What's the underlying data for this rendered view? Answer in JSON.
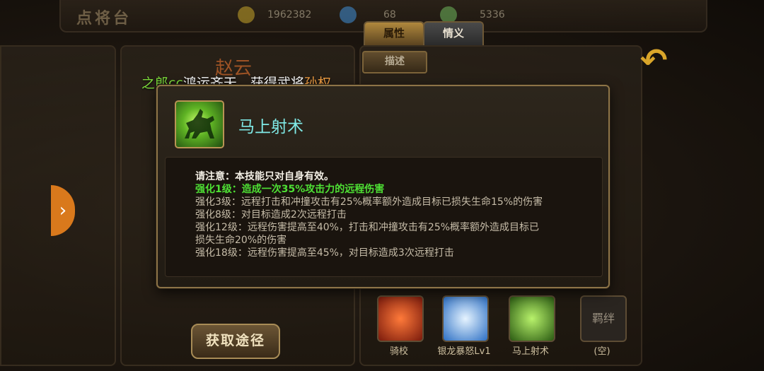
{
  "top_bar": {
    "title": "点将台",
    "resources": [
      {
        "icon": "coin-plus-icon",
        "value": "1962382",
        "color": "#c8a62a"
      },
      {
        "icon": "gem-plus-icon",
        "value": "68",
        "color": "#3f8fd9"
      },
      {
        "icon": "soul-icon",
        "value": "5336",
        "color": "#6fb85d"
      }
    ]
  },
  "tabs": [
    {
      "label": "属性",
      "active": true
    },
    {
      "label": "情义",
      "active": false
    }
  ],
  "subtab": {
    "label": "描述"
  },
  "hero": {
    "name": "赵云"
  },
  "broadcast": {
    "player": "之郎cc",
    "text1": "鸿运齐天，获得武将",
    "hero": "孙权",
    "text2": "。"
  },
  "popup": {
    "skill_name": "马上射术",
    "skill_icon": "horse-archer-icon",
    "lines": [
      {
        "text": "请注意：本技能只对自身有效。",
        "style": "note"
      },
      {
        "text": "强化1级：造成一次35%攻击力的远程伤害",
        "style": "green"
      },
      {
        "text": "强化3级：远程打击和冲撞攻击有25%概率额外造成目标已损失生命15%的伤害",
        "style": "normal"
      },
      {
        "text": "强化8级：对目标造成2次远程打击",
        "style": "normal"
      },
      {
        "text": "强化12级：远程伤害提高至40%，打击和冲撞攻击有25%概率额外造成目标已",
        "style": "normal"
      },
      {
        "text": "损失生命20%的伤害",
        "style": "normal"
      },
      {
        "text": "强化18级：远程伤害提高至45%，对目标造成3次远程打击",
        "style": "normal"
      }
    ]
  },
  "obtain_button": {
    "label": "获取途径"
  },
  "skills": [
    {
      "label": "骑校",
      "icon": "cavalry-icon",
      "color": "#c0331c"
    },
    {
      "label": "银龙暴怒Lv1",
      "icon": "silver-dragon-icon",
      "color": "#4a8fe0"
    },
    {
      "label": "马上射术",
      "icon": "horse-archer-icon",
      "color": "#5fb324"
    },
    {
      "label": "(空)",
      "icon": "bond-icon",
      "slot_text": "羁绊",
      "color": "#3a3a3a"
    }
  ]
}
